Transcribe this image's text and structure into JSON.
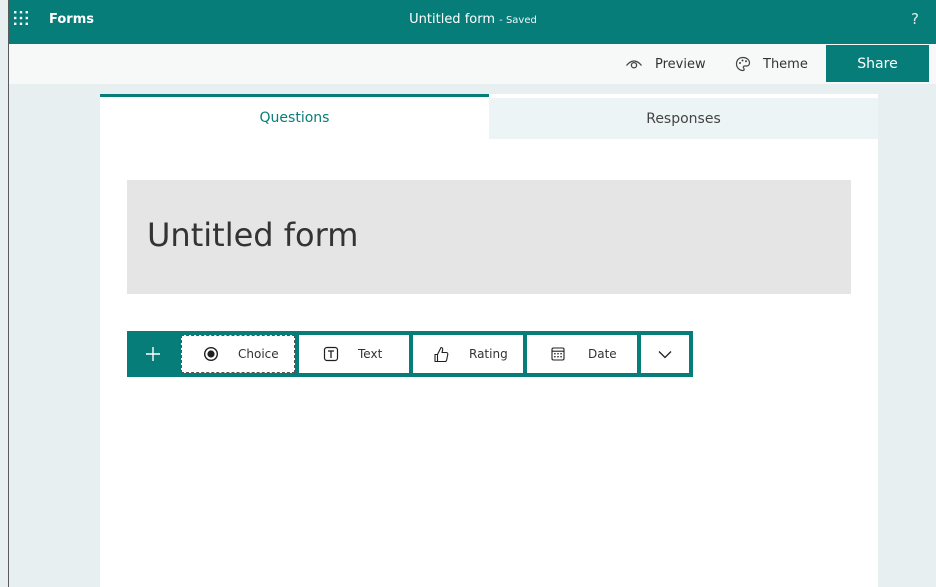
{
  "app": {
    "name": "Forms"
  },
  "header": {
    "doc_title": "Untitled form",
    "status": "- Saved",
    "help": "?"
  },
  "command_bar": {
    "preview_label": "Preview",
    "theme_label": "Theme",
    "share_label": "Share"
  },
  "tabs": [
    {
      "label": "Questions",
      "active": true
    },
    {
      "label": "Responses",
      "active": false
    }
  ],
  "form": {
    "title": "Untitled form"
  },
  "question_types": {
    "add_icon": "plus-icon",
    "items": [
      {
        "label": "Choice",
        "icon": "radio-icon"
      },
      {
        "label": "Text",
        "icon": "text-box-icon"
      },
      {
        "label": "Rating",
        "icon": "thumbs-up-icon"
      },
      {
        "label": "Date",
        "icon": "calendar-icon"
      }
    ],
    "more_icon": "chevron-down-icon"
  },
  "colors": {
    "accent": "#077d7a",
    "page_background": "#e8eff1",
    "title_box": "#e5e5e5",
    "inactive_tab": "#edf4f5"
  }
}
